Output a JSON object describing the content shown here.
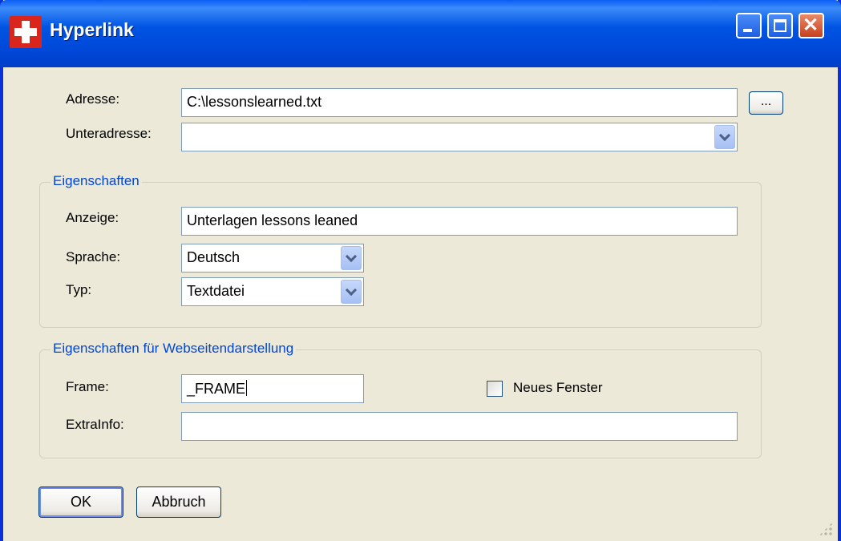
{
  "window": {
    "title": "Hyperlink"
  },
  "form": {
    "address_label": "Adresse:",
    "address_value": "C:\\lessonslearned.txt",
    "browse_label": "...",
    "subaddress_label": "Unteradresse:",
    "subaddress_value": ""
  },
  "properties": {
    "title": "Eigenschaften",
    "display_label": "Anzeige:",
    "display_value": "Unterlagen lessons leaned",
    "language_label": "Sprache:",
    "language_value": "Deutsch",
    "type_label": "Typ:",
    "type_value": "Textdatei"
  },
  "web": {
    "title": "Eigenschaften für Webseitendarstellung",
    "frame_label": "Frame:",
    "frame_value": "_FRAME",
    "new_window_label": "Neues Fenster",
    "new_window_checked": false,
    "extrainfo_label": "ExtraInfo:",
    "extrainfo_value": ""
  },
  "buttons": {
    "ok": "OK",
    "cancel": "Abbruch"
  },
  "icons": [
    "app-cross-icon",
    "minimize-icon",
    "maximize-icon",
    "close-icon",
    "chevron-down-icon",
    "resize-grip-icon"
  ]
}
